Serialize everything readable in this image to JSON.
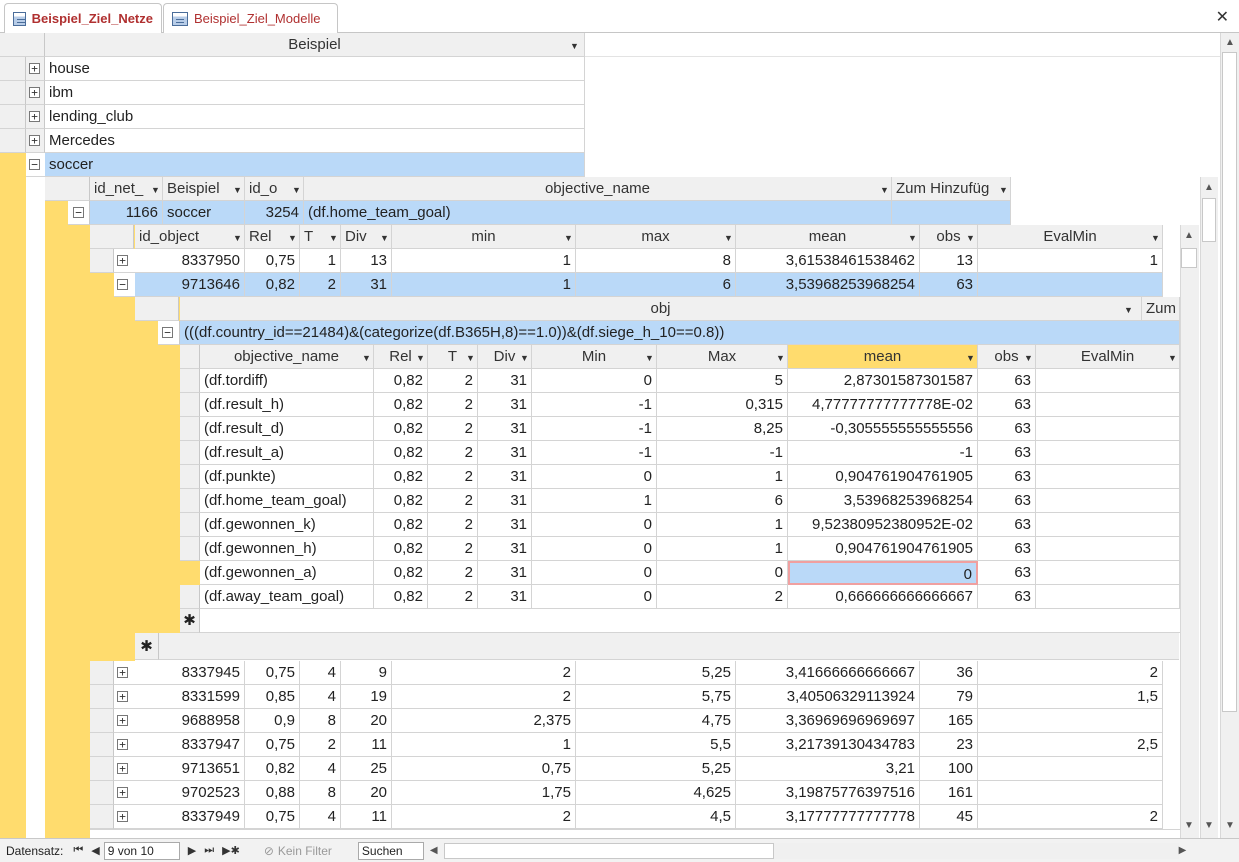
{
  "tabs": [
    {
      "label": "Beispiel_Ziel_Netze",
      "active": true
    },
    {
      "label": "Beispiel_Ziel_Modelle",
      "active": false
    }
  ],
  "outer": {
    "header": "Beispiel",
    "items": [
      "house",
      "ibm",
      "lending_club",
      "Mercedes",
      "soccer"
    ]
  },
  "level2": {
    "headers": [
      "id_net_",
      "Beispiel",
      "id_o",
      "objective_name",
      "Zum Hinzufüg"
    ],
    "row": {
      "id_net": "1166",
      "beispiel": "soccer",
      "id_o": "3254",
      "objective_name": "(df.home_team_goal)"
    }
  },
  "level3": {
    "headers": [
      "id_object",
      "Rel",
      "T",
      "Div",
      "min",
      "max",
      "mean",
      "obs",
      "EvalMin"
    ],
    "rows": [
      {
        "id": "8337950",
        "rel": "0,75",
        "t": "1",
        "div": "13",
        "min": "1",
        "max": "8",
        "mean": "3,61538461538462",
        "obs": "13",
        "evalmin": "1"
      },
      {
        "id": "9713646",
        "rel": "0,82",
        "t": "2",
        "div": "31",
        "min": "1",
        "max": "6",
        "mean": "3,53968253968254",
        "obs": "63",
        "evalmin": ""
      }
    ],
    "rows_after": [
      {
        "id": "8337945",
        "rel": "0,75",
        "t": "4",
        "div": "9",
        "min": "2",
        "max": "5,25",
        "mean": "3,41666666666667",
        "obs": "36",
        "evalmin": "2"
      },
      {
        "id": "8331599",
        "rel": "0,85",
        "t": "4",
        "div": "19",
        "min": "2",
        "max": "5,75",
        "mean": "3,40506329113924",
        "obs": "79",
        "evalmin": "1,5"
      },
      {
        "id": "9688958",
        "rel": "0,9",
        "t": "8",
        "div": "20",
        "min": "2,375",
        "max": "4,75",
        "mean": "3,36969696969697",
        "obs": "165",
        "evalmin": ""
      },
      {
        "id": "8337947",
        "rel": "0,75",
        "t": "2",
        "div": "11",
        "min": "1",
        "max": "5,5",
        "mean": "3,21739130434783",
        "obs": "23",
        "evalmin": "2,5"
      },
      {
        "id": "9713651",
        "rel": "0,82",
        "t": "4",
        "div": "25",
        "min": "0,75",
        "max": "5,25",
        "mean": "3,21",
        "obs": "100",
        "evalmin": ""
      },
      {
        "id": "9702523",
        "rel": "0,88",
        "t": "8",
        "div": "20",
        "min": "1,75",
        "max": "4,625",
        "mean": "3,19875776397516",
        "obs": "161",
        "evalmin": ""
      },
      {
        "id": "8337949",
        "rel": "0,75",
        "t": "4",
        "div": "11",
        "min": "2",
        "max": "4,5",
        "mean": "3,17777777777778",
        "obs": "45",
        "evalmin": "2"
      }
    ]
  },
  "level4": {
    "header": "obj",
    "header_right": "Zum",
    "value": "(((df.country_id==21484)&(categorize(df.B365H,8)==1.0))&(df.siege_h_10==0.8))"
  },
  "level5": {
    "headers": [
      "objective_name",
      "Rel",
      "T",
      "Div",
      "Min",
      "Max",
      "mean",
      "obs",
      "EvalMin"
    ],
    "rows": [
      {
        "name": "(df.tordiff)",
        "rel": "0,82",
        "t": "2",
        "div": "31",
        "min": "0",
        "max": "5",
        "mean": "2,87301587301587",
        "obs": "63"
      },
      {
        "name": "(df.result_h)",
        "rel": "0,82",
        "t": "2",
        "div": "31",
        "min": "-1",
        "max": "0,315",
        "mean": "4,77777777777778E-02",
        "obs": "63"
      },
      {
        "name": "(df.result_d)",
        "rel": "0,82",
        "t": "2",
        "div": "31",
        "min": "-1",
        "max": "8,25",
        "mean": "-0,305555555555556",
        "obs": "63"
      },
      {
        "name": "(df.result_a)",
        "rel": "0,82",
        "t": "2",
        "div": "31",
        "min": "-1",
        "max": "-1",
        "mean": "-1",
        "obs": "63"
      },
      {
        "name": "(df.punkte)",
        "rel": "0,82",
        "t": "2",
        "div": "31",
        "min": "0",
        "max": "1",
        "mean": "0,904761904761905",
        "obs": "63"
      },
      {
        "name": "(df.home_team_goal)",
        "rel": "0,82",
        "t": "2",
        "div": "31",
        "min": "1",
        "max": "6",
        "mean": "3,53968253968254",
        "obs": "63"
      },
      {
        "name": "(df.gewonnen_k)",
        "rel": "0,82",
        "t": "2",
        "div": "31",
        "min": "0",
        "max": "1",
        "mean": "9,52380952380952E-02",
        "obs": "63"
      },
      {
        "name": "(df.gewonnen_h)",
        "rel": "0,82",
        "t": "2",
        "div": "31",
        "min": "0",
        "max": "1",
        "mean": "0,904761904761905",
        "obs": "63"
      },
      {
        "name": "(df.gewonnen_a)",
        "rel": "0,82",
        "t": "2",
        "div": "31",
        "min": "0",
        "max": "0",
        "mean": "0",
        "obs": "63"
      },
      {
        "name": "(df.away_team_goal)",
        "rel": "0,82",
        "t": "2",
        "div": "31",
        "min": "0",
        "max": "2",
        "mean": "0,666666666666667",
        "obs": "63"
      }
    ],
    "new_row_marker": "✱"
  },
  "status": {
    "label": "Datensatz:",
    "record": "9 von 10",
    "filter": "Kein Filter",
    "search": "Suchen"
  }
}
